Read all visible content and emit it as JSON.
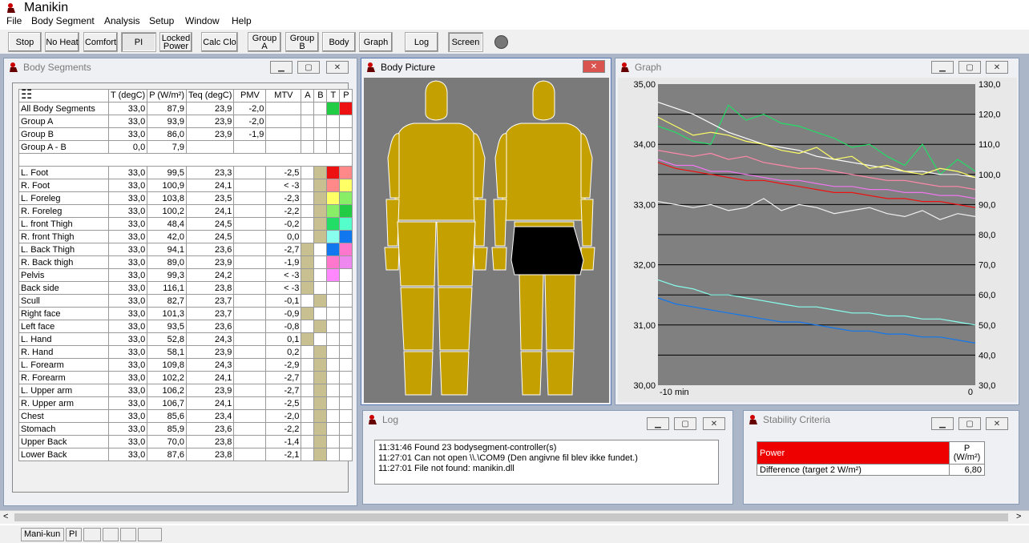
{
  "app": {
    "title": "Manikin"
  },
  "menu": [
    "File",
    "Body Segment",
    "Analysis",
    "Setup",
    "Window",
    "Help"
  ],
  "toolbar": [
    {
      "label": "Stop"
    },
    {
      "label": "No Heat"
    },
    {
      "label": "Comfort"
    },
    {
      "label": "PI"
    },
    {
      "label": "Locked Power"
    },
    {
      "label": "Calc Clo"
    },
    {
      "label": "Group A"
    },
    {
      "label": "Group B"
    },
    {
      "label": "Body"
    },
    {
      "label": "Graph"
    },
    {
      "label": "Log"
    },
    {
      "label": "Screen"
    }
  ],
  "segments_window": {
    "title": "Body Segments",
    "headers": [
      "T (degC)",
      "P (W/m²)",
      "Teq (degC)",
      "PMV",
      "MTV",
      "A",
      "B",
      "T",
      "P"
    ],
    "group_rows": [
      {
        "name": "All Body Segments",
        "t": "33,0",
        "p": "87,9",
        "teq": "23,9",
        "pmv": "-2,0",
        "mtv": "",
        "cT": "#22cc44",
        "cP": "#ee1111"
      },
      {
        "name": "Group A",
        "t": "33,0",
        "p": "93,9",
        "teq": "23,9",
        "pmv": "-2,0",
        "mtv": "",
        "cT": "",
        "cP": ""
      },
      {
        "name": "Group B",
        "t": "33,0",
        "p": "86,0",
        "teq": "23,9",
        "pmv": "-1,9",
        "mtv": "",
        "cT": "",
        "cP": ""
      },
      {
        "name": "Group A - B",
        "t": "0,0",
        "p": "7,9",
        "teq": "",
        "pmv": "",
        "mtv": "",
        "cT": "",
        "cP": ""
      }
    ],
    "rows": [
      {
        "name": "L. Foot",
        "t": "33,0",
        "p": "99,5",
        "teq": "23,3",
        "mtv": "-2,5",
        "a": false,
        "b": true,
        "cT": "#ee1111",
        "cP": "#ff8888"
      },
      {
        "name": "R. Foot",
        "t": "33,0",
        "p": "100,9",
        "teq": "24,1",
        "mtv": "< -3",
        "a": false,
        "b": true,
        "cT": "#ff8888",
        "cP": "#ffff66"
      },
      {
        "name": "L. Foreleg",
        "t": "33,0",
        "p": "103,8",
        "teq": "23,5",
        "mtv": "-2,3",
        "a": false,
        "b": true,
        "cT": "#ffff66",
        "cP": "#88ee66"
      },
      {
        "name": "R. Foreleg",
        "t": "33,0",
        "p": "100,2",
        "teq": "24,1",
        "mtv": "-2,2",
        "a": false,
        "b": true,
        "cT": "#88ee66",
        "cP": "#22cc44"
      },
      {
        "name": "L. front Thigh",
        "t": "33,0",
        "p": "48,4",
        "teq": "24,5",
        "mtv": "-0,2",
        "a": false,
        "b": true,
        "cT": "#22dd66",
        "cP": "#55ffcc"
      },
      {
        "name": "R. front Thigh",
        "t": "33,0",
        "p": "42,0",
        "teq": "24,5",
        "mtv": "0,0",
        "a": false,
        "b": true,
        "cT": "#88ffee",
        "cP": "#1177ee"
      },
      {
        "name": "L. Back Thigh",
        "t": "33,0",
        "p": "94,1",
        "teq": "23,6",
        "mtv": "-2,7",
        "a": true,
        "b": false,
        "cT": "#1177ee",
        "cP": "#ff77cc"
      },
      {
        "name": "R. Back thigh",
        "t": "33,0",
        "p": "89,0",
        "teq": "23,9",
        "mtv": "-1,9",
        "a": true,
        "b": false,
        "cT": "#ff77cc",
        "cP": "#ee88ee"
      },
      {
        "name": "Pelvis",
        "t": "33,0",
        "p": "99,3",
        "teq": "24,2",
        "mtv": "< -3",
        "a": true,
        "b": false,
        "cT": "#ff88ff",
        "cP": ""
      },
      {
        "name": "Back side",
        "t": "33,0",
        "p": "116,1",
        "teq": "23,8",
        "mtv": "< -3",
        "a": true,
        "b": false,
        "cT": "",
        "cP": ""
      },
      {
        "name": "Scull",
        "t": "33,0",
        "p": "82,7",
        "teq": "23,7",
        "mtv": "-0,1",
        "a": false,
        "b": true,
        "cT": "",
        "cP": ""
      },
      {
        "name": "Right face",
        "t": "33,0",
        "p": "101,3",
        "teq": "23,7",
        "mtv": "-0,9",
        "a": true,
        "b": false,
        "cT": "",
        "cP": ""
      },
      {
        "name": "Left face",
        "t": "33,0",
        "p": "93,5",
        "teq": "23,6",
        "mtv": "-0,8",
        "a": false,
        "b": true,
        "cT": "",
        "cP": ""
      },
      {
        "name": "L.  Hand",
        "t": "33,0",
        "p": "52,8",
        "teq": "24,3",
        "mtv": "0,1",
        "a": true,
        "b": false,
        "cT": "",
        "cP": ""
      },
      {
        "name": "R.  Hand",
        "t": "33,0",
        "p": "58,1",
        "teq": "23,9",
        "mtv": "0,2",
        "a": false,
        "b": true,
        "cT": "",
        "cP": ""
      },
      {
        "name": "L. Forearm",
        "t": "33,0",
        "p": "109,8",
        "teq": "24,3",
        "mtv": "-2,9",
        "a": false,
        "b": true,
        "cT": "",
        "cP": ""
      },
      {
        "name": "R. Forearm",
        "t": "33,0",
        "p": "102,2",
        "teq": "24,1",
        "mtv": "-2,7",
        "a": false,
        "b": true,
        "cT": "",
        "cP": ""
      },
      {
        "name": "L.  Upper arm",
        "t": "33,0",
        "p": "106,2",
        "teq": "23,9",
        "mtv": "-2,7",
        "a": false,
        "b": true,
        "cT": "",
        "cP": ""
      },
      {
        "name": "R.  Upper arm",
        "t": "33,0",
        "p": "106,7",
        "teq": "24,1",
        "mtv": "-2,5",
        "a": false,
        "b": true,
        "cT": "",
        "cP": ""
      },
      {
        "name": "Chest",
        "t": "33,0",
        "p": "85,6",
        "teq": "23,4",
        "mtv": "-2,0",
        "a": false,
        "b": true,
        "cT": "",
        "cP": ""
      },
      {
        "name": "Stomach",
        "t": "33,0",
        "p": "85,9",
        "teq": "23,6",
        "mtv": "-2,2",
        "a": false,
        "b": true,
        "cT": "",
        "cP": ""
      },
      {
        "name": "Upper Back",
        "t": "33,0",
        "p": "70,0",
        "teq": "23,8",
        "mtv": "-1,4",
        "a": false,
        "b": true,
        "cT": "",
        "cP": ""
      },
      {
        "name": "Lower Back",
        "t": "33,0",
        "p": "87,6",
        "teq": "23,8",
        "mtv": "-2,1",
        "a": false,
        "b": true,
        "cT": "",
        "cP": ""
      }
    ]
  },
  "body_window": {
    "title": "Body Picture",
    "body_color": "#c4a000",
    "highlight_color": "#000000"
  },
  "graph_window": {
    "title": "Graph"
  },
  "log_window": {
    "title": "Log",
    "lines": [
      "11:31:46 Found 23 bodysegment-controller(s)",
      "11:27:01 Can not open \\\\.\\COM9 (Den angivne fil blev ikke fundet.)",
      "11:27:01 File not found: manikin.dll"
    ]
  },
  "stability_window": {
    "title": "Stability Criteria",
    "header_label": "Power",
    "header_unit": "P (W/m²)",
    "row_label": "Difference (target 2 W/m²)",
    "row_value": "6,80"
  },
  "statusbar": [
    "Mani-kun",
    "PI"
  ],
  "chart_data": {
    "type": "line",
    "x_label_left": "-10 min",
    "x_label_right": "0",
    "y_left": {
      "ticks": [
        "35,00",
        "34,00",
        "33,00",
        "32,00",
        "31,00",
        "30,00"
      ],
      "range": [
        30,
        35
      ]
    },
    "y_right": {
      "ticks": [
        "130,0",
        "120,0",
        "110,0",
        "100,0",
        "90,0",
        "80,0",
        "70,0",
        "60,0",
        "50,0",
        "40,0",
        "30,0"
      ],
      "range": [
        30,
        130
      ]
    },
    "grid": true,
    "series": [
      {
        "color": "#22dd66",
        "axis": "right",
        "values": [
          116,
          114,
          111,
          110,
          123,
          118,
          120,
          117,
          116,
          114,
          112,
          109,
          110,
          106,
          103,
          110,
          100,
          105,
          101
        ]
      },
      {
        "color": "#ffffff",
        "axis": "right",
        "values": [
          124,
          122,
          120,
          117,
          114,
          112,
          110,
          109,
          108,
          106,
          105,
          104,
          103,
          102,
          101,
          101,
          100,
          100,
          99
        ]
      },
      {
        "color": "#ffff66",
        "axis": "right",
        "values": [
          119,
          116,
          113,
          114,
          113,
          111,
          110,
          108,
          107,
          109,
          105,
          106,
          102,
          103,
          101,
          100,
          102,
          101,
          99
        ]
      },
      {
        "color": "#ff88aa",
        "axis": "right",
        "values": [
          108,
          107,
          106,
          107,
          105,
          106,
          104,
          103,
          102,
          102,
          101,
          100,
          99,
          98,
          98,
          97,
          96,
          96,
          95
        ]
      },
      {
        "color": "#ee1111",
        "axis": "right",
        "values": [
          104,
          102,
          101,
          100,
          99,
          98,
          98,
          97,
          96,
          95,
          94,
          94,
          93,
          92,
          92,
          91,
          91,
          90,
          89
        ]
      },
      {
        "color": "#ee77ee",
        "axis": "right",
        "values": [
          105,
          103,
          103,
          101,
          101,
          100,
          99,
          98,
          98,
          97,
          96,
          96,
          95,
          95,
          94,
          94,
          93,
          93,
          92
        ]
      },
      {
        "color": "#f0f0f0",
        "axis": "right",
        "values": [
          91,
          90,
          89,
          90,
          88,
          89,
          92,
          88,
          90,
          89,
          87,
          88,
          89,
          87,
          86,
          88,
          85,
          87,
          86
        ]
      },
      {
        "color": "#88ffee",
        "axis": "right",
        "values": [
          65,
          63,
          62,
          60,
          60,
          59,
          58,
          57,
          56,
          56,
          55,
          54,
          54,
          53,
          53,
          52,
          52,
          51,
          50
        ]
      },
      {
        "color": "#1177ee",
        "axis": "right",
        "values": [
          59,
          57,
          56,
          55,
          54,
          53,
          52,
          51,
          51,
          50,
          49,
          48,
          48,
          47,
          47,
          46,
          46,
          45,
          44
        ]
      }
    ]
  }
}
